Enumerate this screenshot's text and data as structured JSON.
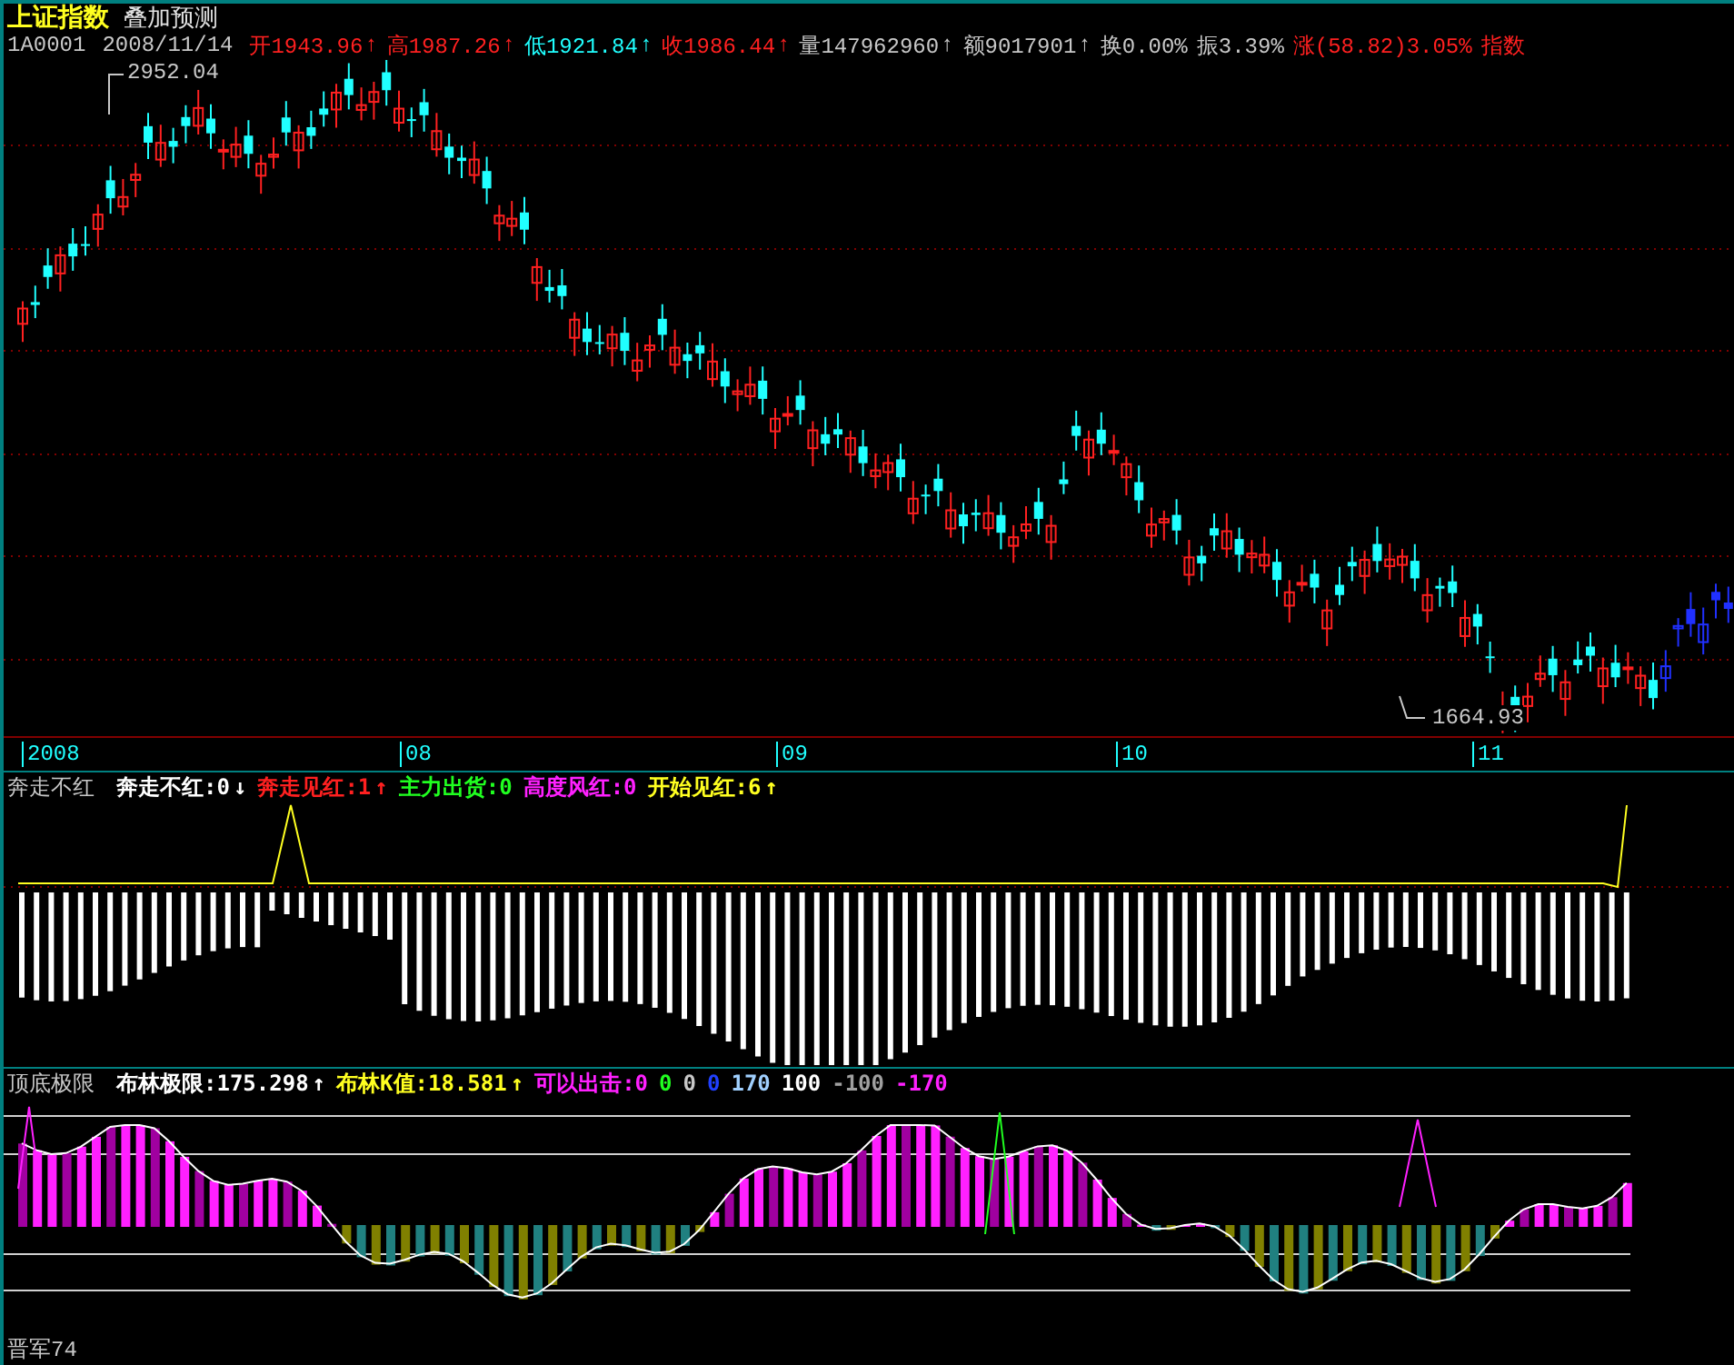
{
  "header": {
    "title": "上证指数",
    "subtitle": "叠加预测"
  },
  "quote": {
    "code": "1A0001",
    "date": "2008/11/14",
    "items": [
      {
        "label": "开",
        "value": "1943.96",
        "arrow": "↑",
        "color": "#ff2020"
      },
      {
        "label": "高",
        "value": "1987.26",
        "arrow": "↑",
        "color": "#ff2020"
      },
      {
        "label": "低",
        "value": "1921.84",
        "arrow": "↑",
        "color": "#20ffff"
      },
      {
        "label": "收",
        "value": "1986.44",
        "arrow": "↑",
        "color": "#ff2020"
      },
      {
        "label": "量",
        "value": "147962960",
        "arrow": "↑",
        "color": "#c8c8c8"
      },
      {
        "label": "额",
        "value": "9017901",
        "arrow": "↑",
        "color": "#c8c8c8"
      },
      {
        "label": "换",
        "value": "0.00%",
        "color": "#c8c8c8"
      },
      {
        "label": "振",
        "value": "3.39%",
        "color": "#c8c8c8"
      },
      {
        "label": "涨",
        "value": "(58.82)3.05%",
        "color": "#ff2020"
      },
      {
        "label": "指数",
        "value": "",
        "color": "#ff2020"
      }
    ]
  },
  "price_labels": {
    "high": "2952.04",
    "low": "1664.93"
  },
  "x_axis": [
    "2008",
    "08",
    "09",
    "10",
    "11"
  ],
  "indicator_1": {
    "name": "奔走不红",
    "items": [
      {
        "text": "奔走不红:0",
        "arrow": "↓",
        "color": "#ffffff"
      },
      {
        "text": "奔走见红:1",
        "arrow": "↑",
        "color": "#ff2020"
      },
      {
        "text": "主力出货:0",
        "color": "#20ff20"
      },
      {
        "text": "高度风红:0",
        "color": "#ff20ff"
      },
      {
        "text": "开始见红:6",
        "arrow": "↑",
        "color": "#ffff20"
      }
    ]
  },
  "indicator_2": {
    "name": "顶底极限",
    "items": [
      {
        "text": "布林极限:175.298",
        "arrow": "↑",
        "color": "#ffffff"
      },
      {
        "text": "布林K值:18.581",
        "arrow": "↑",
        "color": "#ffff20"
      },
      {
        "text": "可以出击:0",
        "color": "#ff20ff"
      },
      {
        "text": "0",
        "color": "#20ff20"
      },
      {
        "text": "0",
        "color": "#c8c8c8"
      },
      {
        "text": "0",
        "color": "#2040ff"
      },
      {
        "text": "170",
        "color": "#a0d0ff"
      },
      {
        "text": "100",
        "color": "#ffffff"
      },
      {
        "text": "-100",
        "color": "#a0a0a0"
      },
      {
        "text": "-170",
        "color": "#ff20ff"
      }
    ]
  },
  "footer": {
    "label": "晋军74"
  }
}
